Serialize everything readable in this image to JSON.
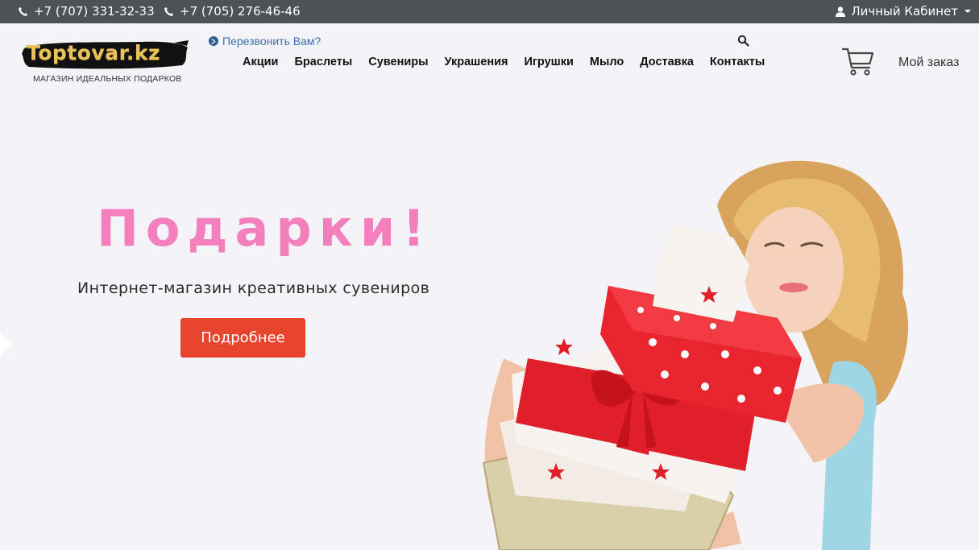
{
  "topbar": {
    "phone1": "+7 (707) 331-32-33",
    "phone2": "+7 (705) 276-46-46",
    "cabinet_label": "Личный Кабинет"
  },
  "header": {
    "logo_text": "Toptovar.kz",
    "logo_tagline": "МАГАЗИН ИДЕАЛЬНЫХ ПОДАРКОВ",
    "callback_label": "Перезвонить Вам?",
    "my_order_label": "Мой заказ"
  },
  "nav": {
    "items": [
      {
        "label": "Акции"
      },
      {
        "label": "Браслеты"
      },
      {
        "label": "Сувениры"
      },
      {
        "label": "Украшения"
      },
      {
        "label": "Игрушки"
      },
      {
        "label": "Мыло"
      },
      {
        "label": "Доставка"
      },
      {
        "label": "Контакты"
      }
    ]
  },
  "hero": {
    "title": "Подарки!",
    "subtitle": "Интернет-магазин креативных сувениров",
    "button_label": "Подробнее"
  },
  "colors": {
    "topbar_bg": "#4c5256",
    "accent_pink": "#f37fbd",
    "button_red": "#e6442c",
    "link_blue": "#3a6fa8"
  },
  "icons": [
    "phone-icon",
    "user-icon",
    "chevron-circle-icon",
    "search-icon",
    "cart-icon",
    "arrow-right-icon"
  ]
}
